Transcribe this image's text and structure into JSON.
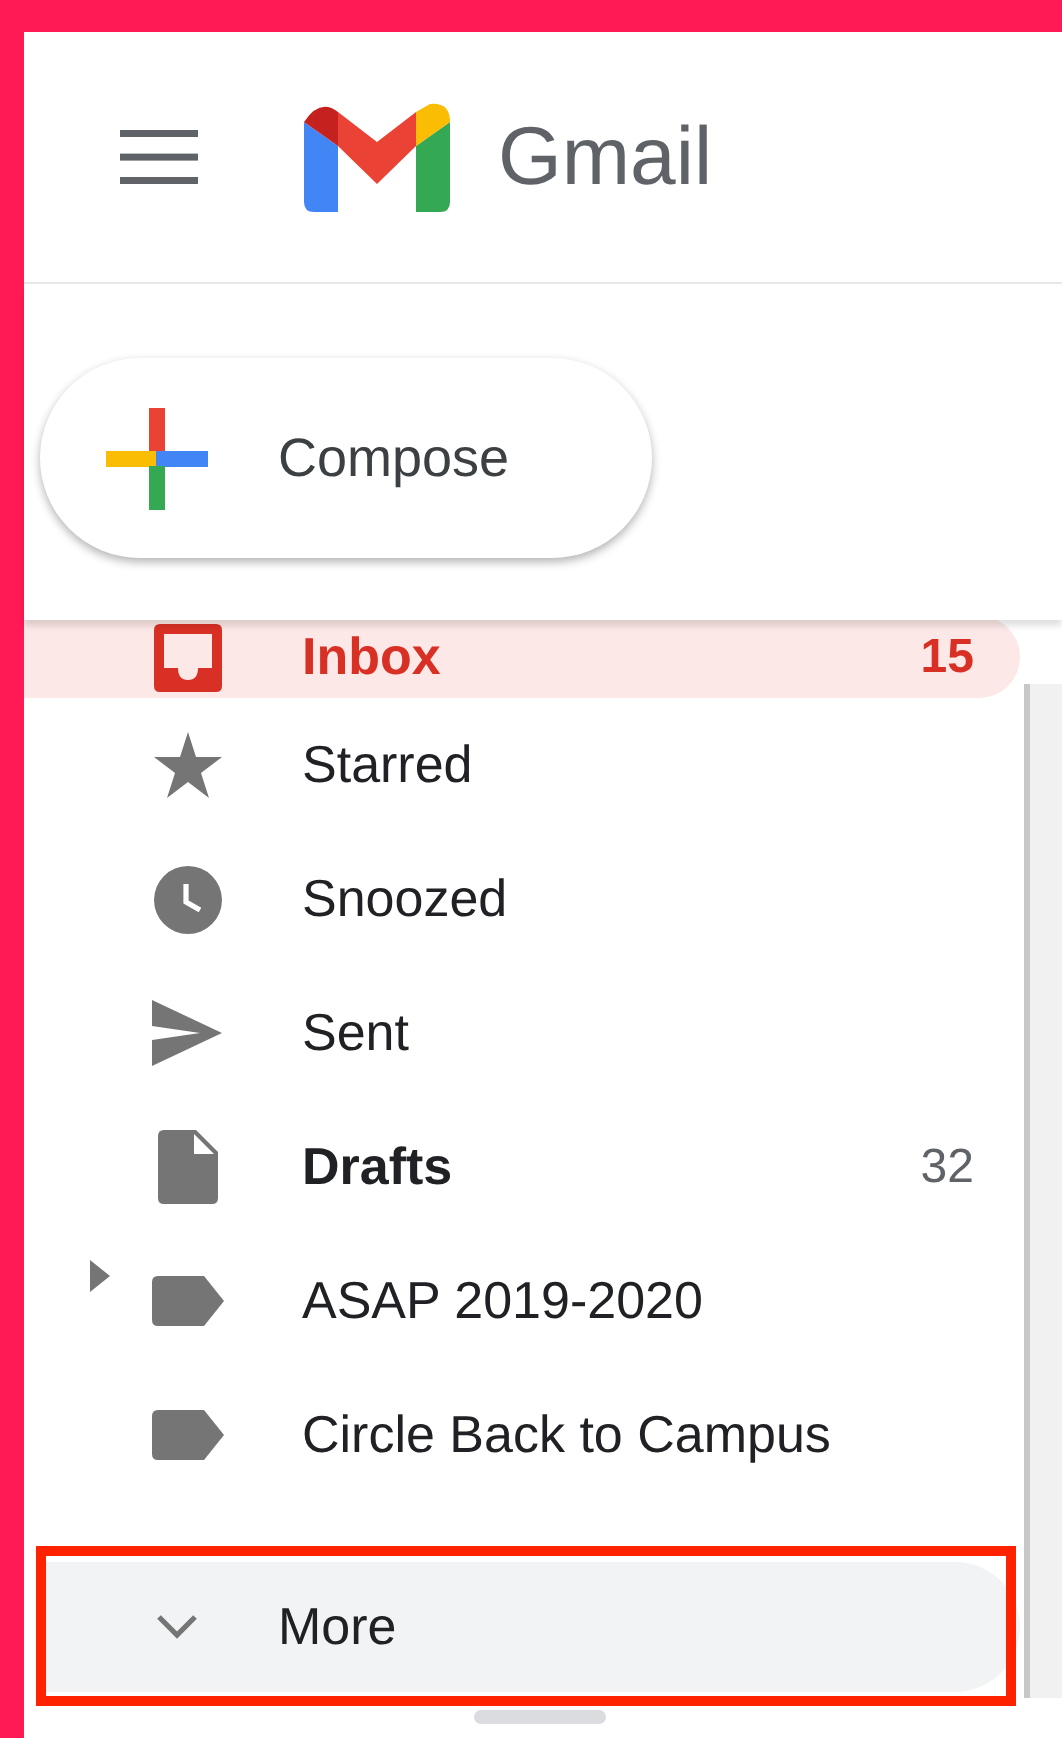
{
  "header": {
    "logo_text": "Gmail"
  },
  "compose": {
    "label": "Compose"
  },
  "nav": {
    "items": [
      {
        "kind": "inbox",
        "label": "Inbox",
        "count": "15",
        "selected": true,
        "unread": true,
        "has_sublabels": false
      },
      {
        "kind": "starred",
        "label": "Starred",
        "selected": false,
        "unread": false,
        "has_sublabels": false
      },
      {
        "kind": "snoozed",
        "label": "Snoozed",
        "selected": false,
        "unread": false,
        "has_sublabels": false
      },
      {
        "kind": "sent",
        "label": "Sent",
        "selected": false,
        "unread": false,
        "has_sublabels": false
      },
      {
        "kind": "drafts",
        "label": "Drafts",
        "count": "32",
        "selected": false,
        "unread": true,
        "has_sublabels": false
      },
      {
        "kind": "label",
        "label": "ASAP 2019-2020",
        "selected": false,
        "unread": false,
        "has_sublabels": true
      },
      {
        "kind": "label",
        "label": "Circle Back to Campus",
        "selected": false,
        "unread": false,
        "has_sublabels": false
      }
    ]
  },
  "more": {
    "label": "More",
    "hovered": true,
    "outlined": true
  }
}
